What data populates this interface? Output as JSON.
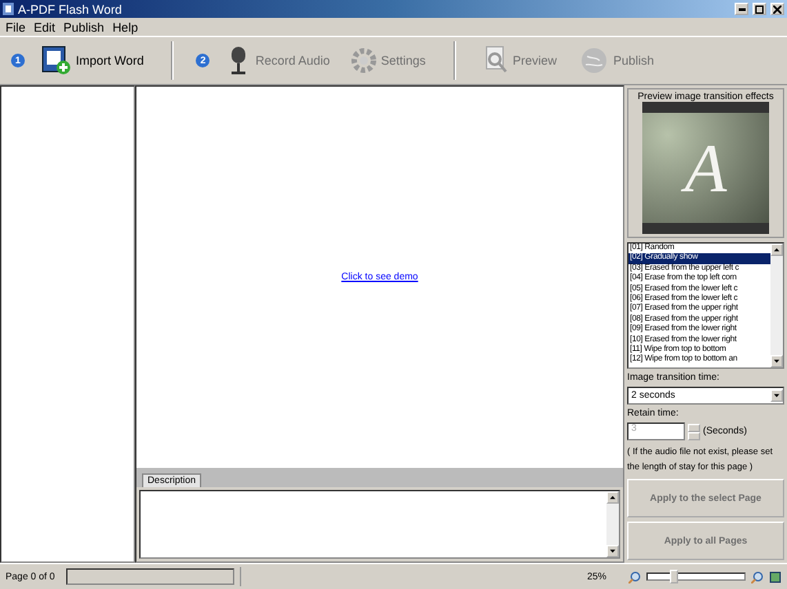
{
  "window": {
    "title": "A-PDF Flash Word"
  },
  "menu": [
    "File",
    "Edit",
    "Publish",
    "Help"
  ],
  "toolbar": [
    {
      "kind": "step",
      "label": "1"
    },
    {
      "kind": "tool",
      "label": "Import Word",
      "disabled": false
    },
    {
      "kind": "sep"
    },
    {
      "kind": "step",
      "label": "2"
    },
    {
      "kind": "tool",
      "label": "Record Audio",
      "disabled": true
    },
    {
      "kind": "tool",
      "label": "Settings",
      "disabled": true
    },
    {
      "kind": "sep"
    },
    {
      "kind": "tool",
      "label": "Preview",
      "disabled": true
    },
    {
      "kind": "tool",
      "label": "Publish",
      "disabled": true
    }
  ],
  "canvas": {
    "link": "Click to see demo"
  },
  "bottom_tabs": [
    {
      "label": "Description",
      "selected": true
    }
  ],
  "preview": {
    "title": "Preview image transition effects",
    "letter": "A"
  },
  "effects": [
    {
      "label": "[01] Random",
      "selected": false
    },
    {
      "label": "[02] Gradually show",
      "selected": true
    },
    {
      "label": "[03] Erased from the upper left c",
      "selected": false
    },
    {
      "label": "[04] Erase from the top left corn",
      "selected": false
    },
    {
      "label": "[05] Erased from the lower left c",
      "selected": false
    },
    {
      "label": "[06] Erased from the lower left c",
      "selected": false
    },
    {
      "label": "[07] Erased from the upper right",
      "selected": false
    },
    {
      "label": "[08] Erased from the upper right",
      "selected": false
    },
    {
      "label": "[09] Erased from the lower right",
      "selected": false
    },
    {
      "label": "[10] Erased from the lower right",
      "selected": false
    },
    {
      "label": "[11] Wipe from top to bottom",
      "selected": false
    },
    {
      "label": "[12] Wipe from top to bottom an",
      "selected": false
    }
  ],
  "transition": {
    "label": "Image transition time:",
    "value": "2 seconds"
  },
  "retain": {
    "label": "Retain time:",
    "value": "3",
    "unit": "(Seconds)",
    "note": "( If the audio file not exist, please set the length of stay for this page )"
  },
  "buttons": [
    {
      "label": "Apply to the select Page",
      "disabled": true
    },
    {
      "label": "Apply to all Pages",
      "disabled": true
    }
  ],
  "status": {
    "page": "Page 0 of 0",
    "zoom": "25%",
    "zoom_slider": {
      "level": 0.27
    }
  }
}
